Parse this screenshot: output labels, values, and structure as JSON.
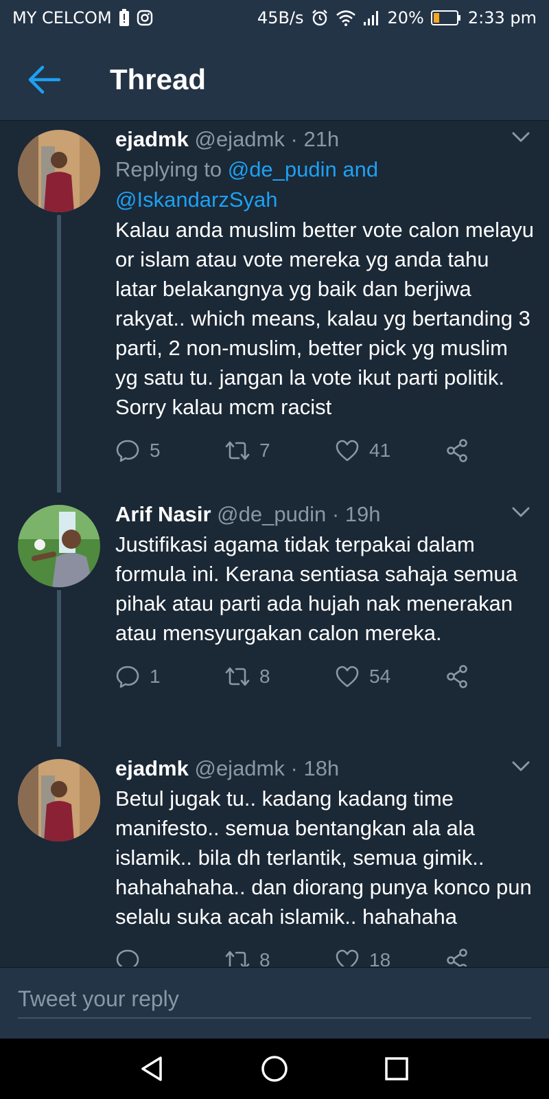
{
  "status_bar": {
    "carrier": "MY CELCOM",
    "speed": "45B/s",
    "battery": "20%",
    "time": "2:33 pm"
  },
  "header": {
    "title": "Thread"
  },
  "tweets": [
    {
      "name": "ejadmk",
      "handle": "@ejadmk",
      "time": "21h",
      "replying_prefix": "Replying to",
      "replying_to_1": "@de_pudin and",
      "replying_to_2": "@IskandarzSyah",
      "text": "Kalau anda muslim better vote calon melayu or islam atau vote mereka yg anda tahu latar belakangnya yg baik dan berjiwa rakyat.. which means, kalau yg bertanding 3 parti, 2 non-muslim, better pick yg muslim yg satu tu. jangan la vote ikut parti politik. Sorry kalau mcm racist",
      "replies": "5",
      "retweets": "7",
      "likes": "41"
    },
    {
      "name": "Arif Nasir",
      "handle": "@de_pudin",
      "time": "19h",
      "text": "Justifikasi agama tidak terpakai dalam formula ini. Kerana sentiasa sahaja semua pihak atau parti ada hujah nak menerakan atau mensyurgakan calon mereka.",
      "replies": "1",
      "retweets": "8",
      "likes": "54"
    },
    {
      "name": "ejadmk",
      "handle": "@ejadmk",
      "time": "18h",
      "text": "Betul jugak tu.. kadang kadang time manifesto.. semua bentangkan ala ala islamik.. bila dh terlantik, semua gimik.. hahahahaha.. dan diorang punya konco pun selalu suka acah islamik.. hahahaha",
      "replies": "",
      "retweets": "8",
      "likes": "18"
    }
  ],
  "reply_bar": {
    "placeholder": "Tweet your reply"
  },
  "colors": {
    "background": "#1b2836",
    "bar": "#243447",
    "accent": "#1da1f2",
    "secondary_text": "#8899a6"
  },
  "icons": {
    "back": "arrow-left-icon",
    "caret": "chevron-down-icon",
    "reply": "speech-bubble-icon",
    "retweet": "retweet-icon",
    "like": "heart-icon",
    "share": "share-icon"
  }
}
